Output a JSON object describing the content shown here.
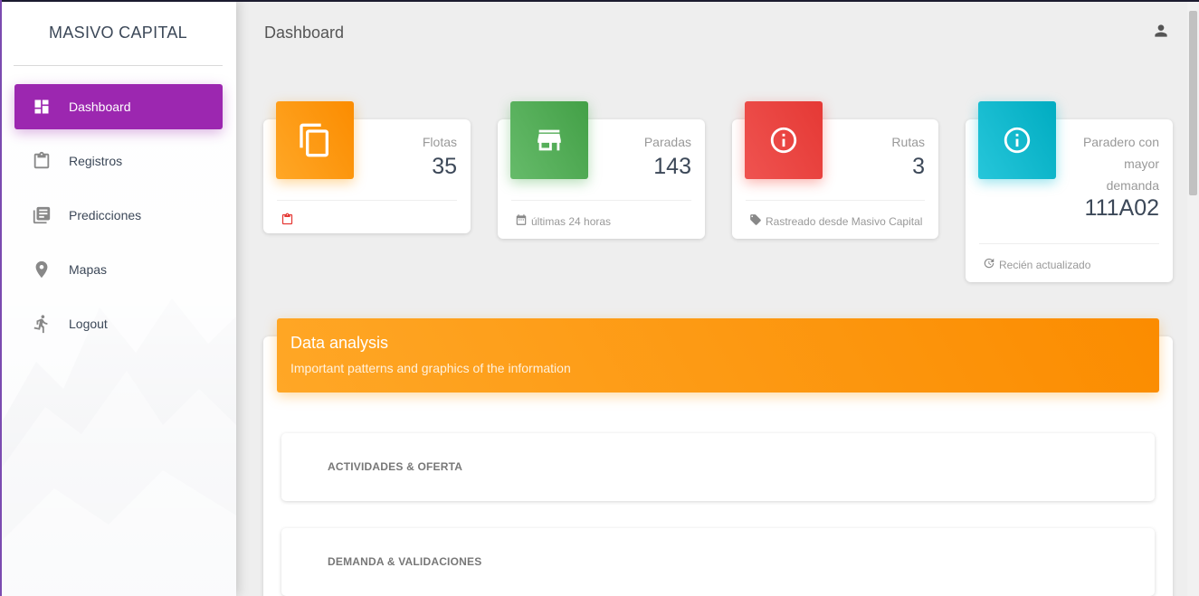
{
  "brand": "MASIVO CAPITAL",
  "sidebar": {
    "items": [
      {
        "label": "Dashboard",
        "icon": "dashboard-icon",
        "active": true
      },
      {
        "label": "Registros",
        "icon": "clipboard-icon"
      },
      {
        "label": "Predicciones",
        "icon": "library-books-icon"
      },
      {
        "label": "Mapas",
        "icon": "location-pin-icon"
      },
      {
        "label": "Logout",
        "icon": "running-person-icon"
      }
    ]
  },
  "header": {
    "title": "Dashboard",
    "user_icon": "person-icon"
  },
  "stats": [
    {
      "category": "Flotas",
      "value": "35",
      "footer": "",
      "icon": "copy-icon",
      "color": "#fb8c00",
      "footer_icon": "clipboard-icon"
    },
    {
      "category": "Paradas",
      "value": "143",
      "footer": "últimas 24 horas",
      "icon": "store-icon",
      "color": "#43a047",
      "footer_icon": "calendar-icon"
    },
    {
      "category": "Rutas",
      "value": "3",
      "footer": "Rastreado desde Masivo Capital",
      "icon": "info-icon",
      "color": "#e53935",
      "footer_icon": "tag-icon"
    },
    {
      "category_lines": [
        "Paradero con",
        "mayor",
        "demanda"
      ],
      "value": "111A02",
      "footer": "Recién actualizado",
      "icon": "info-icon",
      "color": "#00acc1",
      "footer_icon": "update-icon"
    }
  ],
  "analysis": {
    "title": "Data analysis",
    "subtitle": "Important patterns and graphics of the information",
    "sections": [
      "ACTIVIDADES & OFERTA",
      "DEMANDA & VALIDACIONES"
    ]
  },
  "colors": {
    "accent": "#9c27b0",
    "orange": "#fb8c00",
    "green": "#43a047",
    "red": "#e53935",
    "cyan": "#00acc1"
  }
}
